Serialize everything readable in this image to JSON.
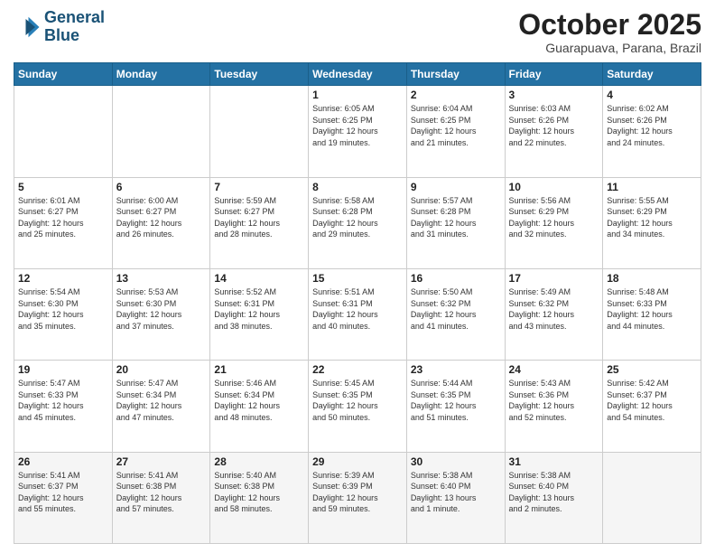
{
  "header": {
    "logo_line1": "General",
    "logo_line2": "Blue",
    "month_title": "October 2025",
    "location": "Guarapuava, Parana, Brazil"
  },
  "weekdays": [
    "Sunday",
    "Monday",
    "Tuesday",
    "Wednesday",
    "Thursday",
    "Friday",
    "Saturday"
  ],
  "weeks": [
    [
      {
        "day": "",
        "info": ""
      },
      {
        "day": "",
        "info": ""
      },
      {
        "day": "",
        "info": ""
      },
      {
        "day": "1",
        "info": "Sunrise: 6:05 AM\nSunset: 6:25 PM\nDaylight: 12 hours\nand 19 minutes."
      },
      {
        "day": "2",
        "info": "Sunrise: 6:04 AM\nSunset: 6:25 PM\nDaylight: 12 hours\nand 21 minutes."
      },
      {
        "day": "3",
        "info": "Sunrise: 6:03 AM\nSunset: 6:26 PM\nDaylight: 12 hours\nand 22 minutes."
      },
      {
        "day": "4",
        "info": "Sunrise: 6:02 AM\nSunset: 6:26 PM\nDaylight: 12 hours\nand 24 minutes."
      }
    ],
    [
      {
        "day": "5",
        "info": "Sunrise: 6:01 AM\nSunset: 6:27 PM\nDaylight: 12 hours\nand 25 minutes."
      },
      {
        "day": "6",
        "info": "Sunrise: 6:00 AM\nSunset: 6:27 PM\nDaylight: 12 hours\nand 26 minutes."
      },
      {
        "day": "7",
        "info": "Sunrise: 5:59 AM\nSunset: 6:27 PM\nDaylight: 12 hours\nand 28 minutes."
      },
      {
        "day": "8",
        "info": "Sunrise: 5:58 AM\nSunset: 6:28 PM\nDaylight: 12 hours\nand 29 minutes."
      },
      {
        "day": "9",
        "info": "Sunrise: 5:57 AM\nSunset: 6:28 PM\nDaylight: 12 hours\nand 31 minutes."
      },
      {
        "day": "10",
        "info": "Sunrise: 5:56 AM\nSunset: 6:29 PM\nDaylight: 12 hours\nand 32 minutes."
      },
      {
        "day": "11",
        "info": "Sunrise: 5:55 AM\nSunset: 6:29 PM\nDaylight: 12 hours\nand 34 minutes."
      }
    ],
    [
      {
        "day": "12",
        "info": "Sunrise: 5:54 AM\nSunset: 6:30 PM\nDaylight: 12 hours\nand 35 minutes."
      },
      {
        "day": "13",
        "info": "Sunrise: 5:53 AM\nSunset: 6:30 PM\nDaylight: 12 hours\nand 37 minutes."
      },
      {
        "day": "14",
        "info": "Sunrise: 5:52 AM\nSunset: 6:31 PM\nDaylight: 12 hours\nand 38 minutes."
      },
      {
        "day": "15",
        "info": "Sunrise: 5:51 AM\nSunset: 6:31 PM\nDaylight: 12 hours\nand 40 minutes."
      },
      {
        "day": "16",
        "info": "Sunrise: 5:50 AM\nSunset: 6:32 PM\nDaylight: 12 hours\nand 41 minutes."
      },
      {
        "day": "17",
        "info": "Sunrise: 5:49 AM\nSunset: 6:32 PM\nDaylight: 12 hours\nand 43 minutes."
      },
      {
        "day": "18",
        "info": "Sunrise: 5:48 AM\nSunset: 6:33 PM\nDaylight: 12 hours\nand 44 minutes."
      }
    ],
    [
      {
        "day": "19",
        "info": "Sunrise: 5:47 AM\nSunset: 6:33 PM\nDaylight: 12 hours\nand 45 minutes."
      },
      {
        "day": "20",
        "info": "Sunrise: 5:47 AM\nSunset: 6:34 PM\nDaylight: 12 hours\nand 47 minutes."
      },
      {
        "day": "21",
        "info": "Sunrise: 5:46 AM\nSunset: 6:34 PM\nDaylight: 12 hours\nand 48 minutes."
      },
      {
        "day": "22",
        "info": "Sunrise: 5:45 AM\nSunset: 6:35 PM\nDaylight: 12 hours\nand 50 minutes."
      },
      {
        "day": "23",
        "info": "Sunrise: 5:44 AM\nSunset: 6:35 PM\nDaylight: 12 hours\nand 51 minutes."
      },
      {
        "day": "24",
        "info": "Sunrise: 5:43 AM\nSunset: 6:36 PM\nDaylight: 12 hours\nand 52 minutes."
      },
      {
        "day": "25",
        "info": "Sunrise: 5:42 AM\nSunset: 6:37 PM\nDaylight: 12 hours\nand 54 minutes."
      }
    ],
    [
      {
        "day": "26",
        "info": "Sunrise: 5:41 AM\nSunset: 6:37 PM\nDaylight: 12 hours\nand 55 minutes."
      },
      {
        "day": "27",
        "info": "Sunrise: 5:41 AM\nSunset: 6:38 PM\nDaylight: 12 hours\nand 57 minutes."
      },
      {
        "day": "28",
        "info": "Sunrise: 5:40 AM\nSunset: 6:38 PM\nDaylight: 12 hours\nand 58 minutes."
      },
      {
        "day": "29",
        "info": "Sunrise: 5:39 AM\nSunset: 6:39 PM\nDaylight: 12 hours\nand 59 minutes."
      },
      {
        "day": "30",
        "info": "Sunrise: 5:38 AM\nSunset: 6:40 PM\nDaylight: 13 hours\nand 1 minute."
      },
      {
        "day": "31",
        "info": "Sunrise: 5:38 AM\nSunset: 6:40 PM\nDaylight: 13 hours\nand 2 minutes."
      },
      {
        "day": "",
        "info": ""
      }
    ]
  ]
}
